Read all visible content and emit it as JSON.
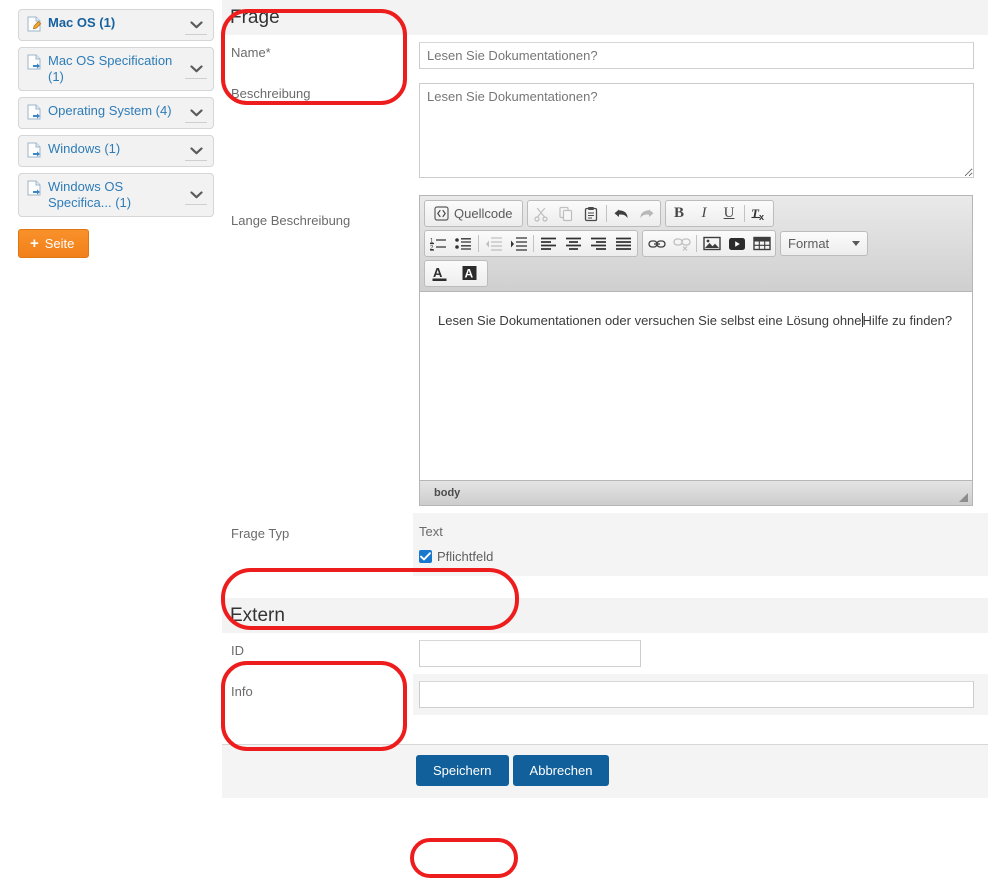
{
  "sidebar": {
    "pages": [
      {
        "label": "Mac OS (1)",
        "icon": "document-edit-icon",
        "active": true
      },
      {
        "label": "Mac OS Specification (1)",
        "icon": "document-arrow-icon",
        "active": false
      },
      {
        "label": "Operating System (4)",
        "icon": "document-arrow-icon",
        "active": false
      },
      {
        "label": "Windows (1)",
        "icon": "document-arrow-icon",
        "active": false
      },
      {
        "label": "Windows OS Specifica... (1)",
        "icon": "document-arrow-icon",
        "active": false
      }
    ],
    "add_page_button": "Seite",
    "add_page_plus": "+",
    "accent_color": "#f5871f"
  },
  "form": {
    "section_frage": "Frage",
    "section_extern": "Extern",
    "labels": {
      "name": "Name*",
      "beschreibung": "Beschreibung",
      "lange_beschreibung": "Lange Beschreibung",
      "frage_typ": "Frage Typ",
      "id": "ID",
      "info": "Info"
    },
    "values": {
      "name": "Lesen Sie Dokumentationen?",
      "beschreibung": "Lesen Sie Dokumentationen?",
      "frage_typ": "Text",
      "id": "",
      "info": ""
    },
    "checkbox": {
      "pflichtfeld_label": "Pflichtfeld",
      "checked": true
    }
  },
  "editor": {
    "toolbar": {
      "source_label": "Quellcode",
      "cut": "cut-icon",
      "copy": "copy-icon",
      "paste": "paste-icon",
      "undo": "undo-icon",
      "redo": "redo-icon",
      "bold": "B",
      "italic": "I",
      "underline": "U",
      "remove_format": "remove-format-icon",
      "numbered_list": "numbered-list-icon",
      "bulleted_list": "bulleted-list-icon",
      "outdent": "outdent-icon",
      "indent": "indent-icon",
      "align_left": "align-left-icon",
      "align_center": "align-center-icon",
      "align_right": "align-right-icon",
      "align_justify": "align-justify-icon",
      "link": "link-icon",
      "unlink": "unlink-icon",
      "image": "image-icon",
      "video": "video-icon",
      "table": "table-icon",
      "format_label": "Format",
      "text_color": "text-color-icon",
      "bg_color": "background-color-icon"
    },
    "content_before_caret": "Lesen Sie Dokumentationen oder versuchen Sie selbst eine Lösung ohne",
    "content_after_caret": "Hilfe zu finden?",
    "status_path": "body"
  },
  "footer": {
    "save_label": "Speichern",
    "cancel_label": "Abbrechen",
    "button_color": "#11609b"
  },
  "annotations": {
    "color": "#ee1d1d",
    "regions": [
      "frage-section-header",
      "frage-typ-row",
      "extern-section-header",
      "speichern-button"
    ]
  }
}
